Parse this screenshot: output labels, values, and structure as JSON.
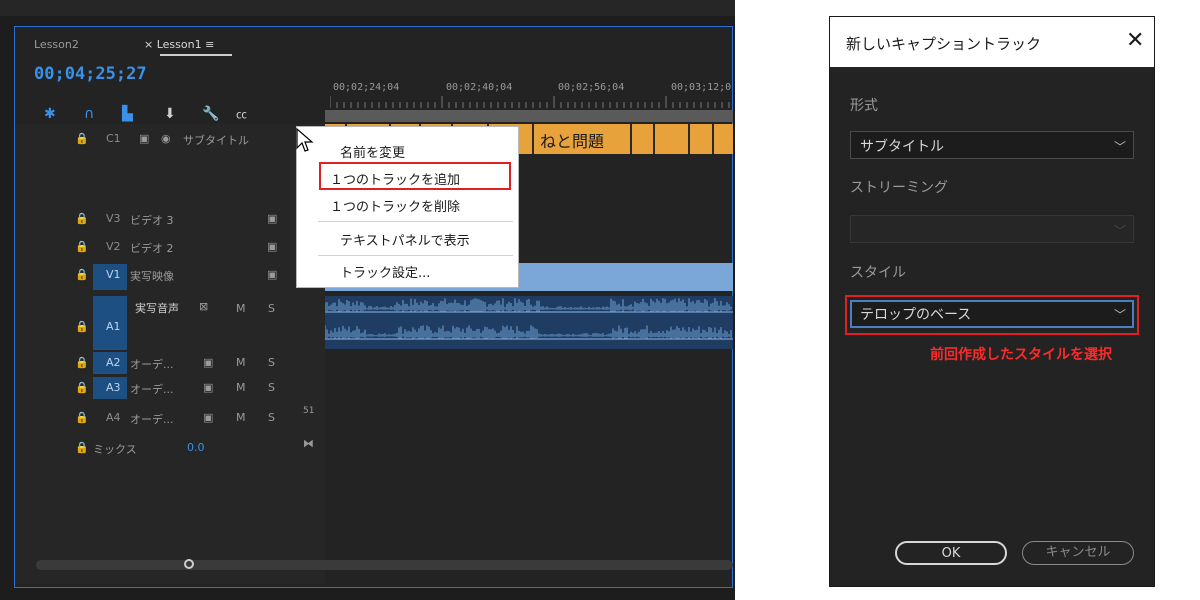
{
  "timeline": {
    "tabs": {
      "lesson2": "Lesson2",
      "lesson1": "× Lesson1 ≡"
    },
    "timecode": "00;04;25;27",
    "ruler_labels": [
      "00;02;24;04",
      "00;02;40;04",
      "00;02;56;04",
      "00;03;12;0"
    ],
    "caption_text": "ねと問題",
    "tracks": [
      {
        "id": "C1",
        "name": "サブタイトル"
      },
      {
        "id": "V3",
        "name": "ビデオ 3"
      },
      {
        "id": "V2",
        "name": "ビデオ 2"
      },
      {
        "id": "V1",
        "name": "実写映像"
      },
      {
        "id": "A1",
        "name": "実写音声"
      },
      {
        "id": "A2",
        "name": "オーデ..."
      },
      {
        "id": "A3",
        "name": "オーデ..."
      },
      {
        "id": "A4",
        "name": "オーデ..."
      }
    ],
    "mix": {
      "label": "ミックス",
      "value": "0.0"
    },
    "toggle_m": "M",
    "toggle_s": "S",
    "channel_label": "51",
    "icons": [
      "snap-icon",
      "magnet-icon",
      "linked-selection-icon",
      "marker-icon",
      "wrench-icon",
      "captions-icon"
    ]
  },
  "context_menu": {
    "items": [
      "名前を変更",
      "１つのトラックを追加",
      "１つのトラックを削除",
      "テキストパネルで表示",
      "トラック設定..."
    ],
    "highlighted_index": 1
  },
  "dialog": {
    "title": "新しいキャプショントラック",
    "format_label": "形式",
    "format_value": "サブタイトル",
    "streaming_label": "ストリーミング",
    "streaming_value": "",
    "style_label": "スタイル",
    "style_value": "テロップのベース",
    "ok": "OK",
    "cancel": "キャンセル"
  },
  "annotation": "前回作成したスタイルを選択",
  "colors": {
    "accent": "#3a91e8",
    "caption_clip": "#e8a23c",
    "video_clip": "#7aa6d8",
    "highlight": "#e02020"
  }
}
